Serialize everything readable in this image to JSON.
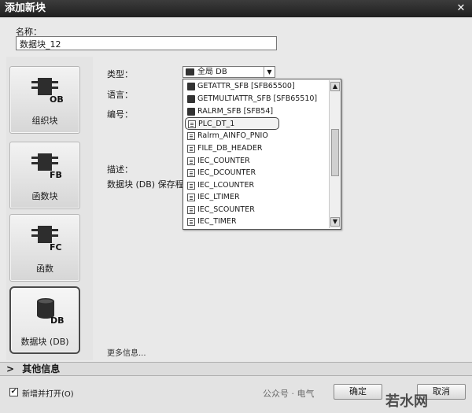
{
  "window": {
    "title": "添加新块",
    "close_glyph": "✕"
  },
  "name": {
    "label": "名称：",
    "value": "数据块_12"
  },
  "blocks": [
    {
      "code": "OB",
      "label": "组织块"
    },
    {
      "code": "FB",
      "label": "函数块"
    },
    {
      "code": "FC",
      "label": "函数"
    },
    {
      "code": "DB",
      "label": "数据块 (DB)"
    }
  ],
  "fields": {
    "type_label": "类型：",
    "language_label": "语言：",
    "number_label": "编号：",
    "description_label": "描述：",
    "description_text": "数据块 (DB) 保存程序"
  },
  "type_select": {
    "value": "全局 DB",
    "arrow": "▼"
  },
  "dropdown": {
    "items": [
      {
        "icon": "fb-icon",
        "text": "GETATTR_SFB  [SFB65500]"
      },
      {
        "icon": "fb-icon",
        "text": "GETMULTIATTR_SFB  [SFB65510]"
      },
      {
        "icon": "fb-icon",
        "text": "RALRM_SFB  [SFB54]"
      },
      {
        "icon": "document-icon",
        "text": "PLC_DT_1"
      },
      {
        "icon": "document-icon",
        "text": "Ralrm_AINFO_PNIO"
      },
      {
        "icon": "document-icon",
        "text": "FILE_DB_HEADER"
      },
      {
        "icon": "document-icon",
        "text": "IEC_COUNTER"
      },
      {
        "icon": "document-icon",
        "text": "IEC_DCOUNTER"
      },
      {
        "icon": "document-icon",
        "text": "IEC_LCOUNTER"
      },
      {
        "icon": "document-icon",
        "text": "IEC_LTIMER"
      },
      {
        "icon": "document-icon",
        "text": "IEC_SCOUNTER"
      },
      {
        "icon": "document-icon",
        "text": "IEC_TIMER"
      }
    ],
    "highlighted": "PLC_DT_1",
    "scroll_up": "▲",
    "scroll_down": "▼"
  },
  "more_info": "更多信息...",
  "other_info": {
    "arrow": ">",
    "label": "其他信息"
  },
  "footer": {
    "add_and_open_label": "新增并打开(O)",
    "add_and_open_checked": "✔",
    "ok_label": "确定",
    "cancel_label": "取消"
  },
  "watermark": {
    "text1": "公众号 · 电气",
    "text2": "若水网"
  }
}
